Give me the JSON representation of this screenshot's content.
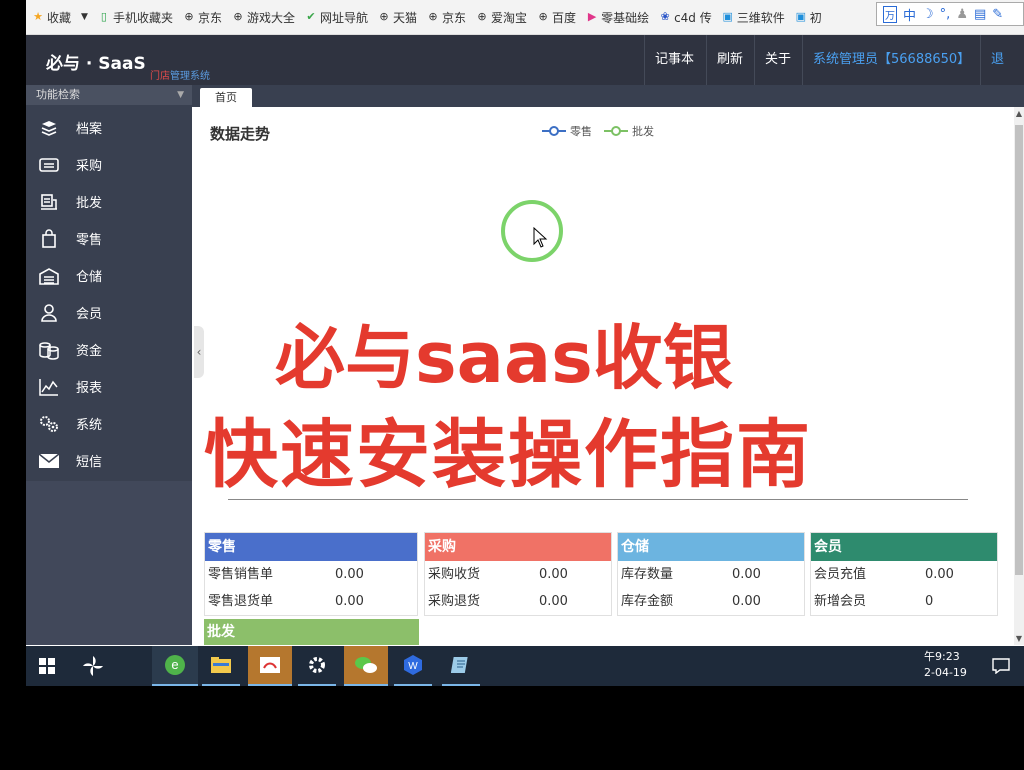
{
  "bookmarks": [
    {
      "icon": "star-icon",
      "label": "收藏"
    },
    {
      "icon": "phone-icon",
      "label": "手机收藏夹"
    },
    {
      "icon": "globe-icon",
      "label": "京东"
    },
    {
      "icon": "globe-icon",
      "label": "游戏大全"
    },
    {
      "icon": "nav-icon",
      "label": "网址导航"
    },
    {
      "icon": "globe-icon",
      "label": "天猫"
    },
    {
      "icon": "globe-icon",
      "label": "京东"
    },
    {
      "icon": "globe-icon",
      "label": "爱淘宝"
    },
    {
      "icon": "globe-icon",
      "label": "百度"
    },
    {
      "icon": "play-icon",
      "label": "零基础绘"
    },
    {
      "icon": "paw-icon",
      "label": "c4d 传"
    },
    {
      "icon": "tv-icon",
      "label": "三维软件"
    },
    {
      "icon": "tv-icon",
      "label": "初"
    }
  ],
  "ime": {
    "mode": "中"
  },
  "app": {
    "logo": "必与 · SaaS",
    "sublogo_a": "门店",
    "sublogo_b": "管理系统",
    "header_buttons": {
      "notes": "记事本",
      "refresh": "刷新",
      "about": "关于",
      "user": "系统管理员【56688650】",
      "exit": "退出"
    }
  },
  "sidebar": {
    "search": "功能检索",
    "items": [
      {
        "icon": "archive-icon",
        "label": "档案"
      },
      {
        "icon": "purchase-icon",
        "label": "采购"
      },
      {
        "icon": "wholesale-icon",
        "label": "批发"
      },
      {
        "icon": "retail-bag-icon",
        "label": "零售"
      },
      {
        "icon": "warehouse-icon",
        "label": "仓储"
      },
      {
        "icon": "member-icon",
        "label": "会员"
      },
      {
        "icon": "funds-icon",
        "label": "资金"
      },
      {
        "icon": "report-chart-icon",
        "label": "报表"
      },
      {
        "icon": "system-gear-icon",
        "label": "系统"
      },
      {
        "icon": "envelope-icon",
        "label": "短信"
      }
    ]
  },
  "tabs": {
    "home": "首页"
  },
  "dashboard": {
    "chart_title": "数据走势",
    "legend": [
      {
        "name": "零售",
        "color": "#3c6fc4"
      },
      {
        "name": "批发",
        "color": "#7cc164"
      }
    ],
    "promo_line1": "必与saas收银",
    "promo_line2": "快速安装操作指南"
  },
  "cards": [
    {
      "title": "零售",
      "color": "#4a6fcb",
      "rows": [
        {
          "label": "零售销售单",
          "value": "0.00"
        },
        {
          "label": "零售退货单",
          "value": "0.00"
        }
      ]
    },
    {
      "title": "采购",
      "color": "#f07266",
      "rows": [
        {
          "label": "采购收货",
          "value": "0.00"
        },
        {
          "label": "采购退货",
          "value": "0.00"
        }
      ]
    },
    {
      "title": "仓储",
      "color": "#6cb4e0",
      "rows": [
        {
          "label": "库存数量",
          "value": "0.00"
        },
        {
          "label": "库存金额",
          "value": "0.00"
        }
      ]
    },
    {
      "title": "会员",
      "color": "#2e8b6e",
      "rows": [
        {
          "label": "会员充值",
          "value": "0.00"
        },
        {
          "label": "新增会员",
          "value": "0"
        }
      ]
    }
  ],
  "card_pifa": {
    "title": "批发",
    "color": "#8cbf6a"
  },
  "taskbar": {
    "time": "午9:23",
    "date": "2-04-19"
  }
}
